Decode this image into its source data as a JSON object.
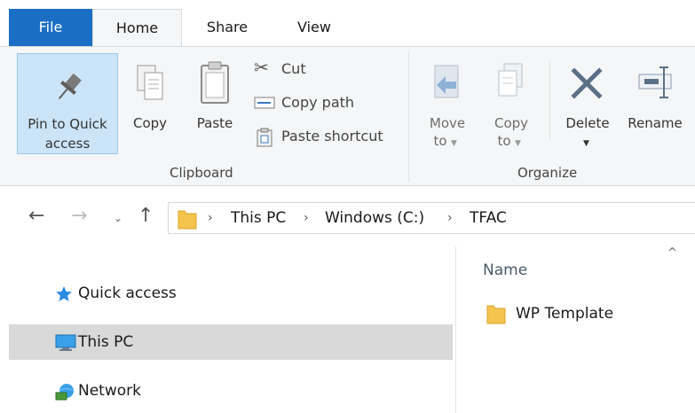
{
  "tabs": {
    "file": "File",
    "home": "Home",
    "share": "Share",
    "view": "View"
  },
  "clipboard": {
    "pin_line1": "Pin to Quick",
    "pin_line2": "access",
    "copy": "Copy",
    "paste": "Paste",
    "cut": "Cut",
    "copy_path": "Copy path",
    "paste_shortcut": "Paste shortcut",
    "group_label": "Clipboard"
  },
  "organize": {
    "move_to_line1": "Move",
    "move_to_line2": "to",
    "copy_to_line1": "Copy",
    "copy_to_line2": "to",
    "delete": "Delete",
    "rename": "Rename",
    "group_label": "Organize"
  },
  "address": {
    "crumbs": [
      "This PC",
      "Windows (C:)",
      "TFAC"
    ]
  },
  "nav": {
    "quick_access": "Quick access",
    "this_pc": "This PC",
    "network": "Network"
  },
  "files": {
    "column_name": "Name",
    "items": [
      {
        "name": "WP Template",
        "icon": "folder-icon"
      }
    ]
  },
  "colors": {
    "file_tab": "#1a6fc4",
    "ribbon_bg": "#f5f6f7",
    "selected_button": "#cce4f7",
    "selected_nav": "#d9d9d9",
    "folder": "#f4c44e"
  }
}
